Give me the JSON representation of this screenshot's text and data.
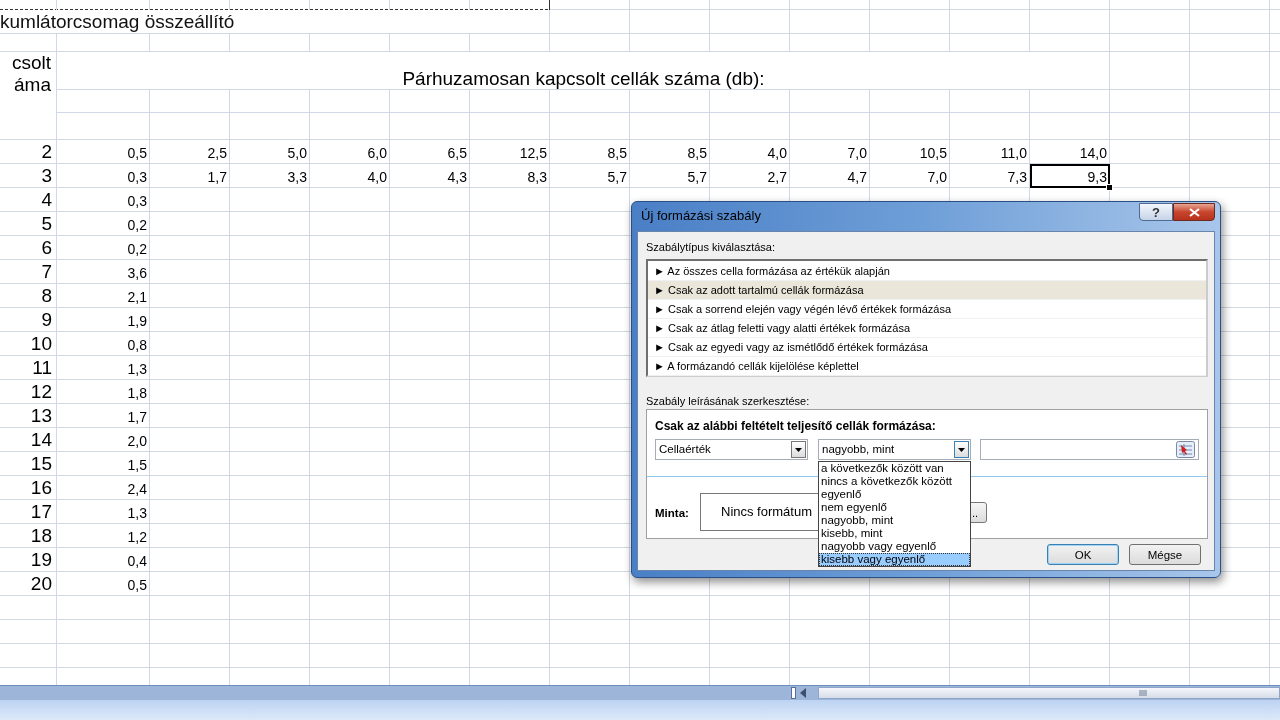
{
  "sheet": {
    "title": "kumlátorcsomag összeállító",
    "left_header": "csolt\náma",
    "header": "Párhuzamosan kapcsolt cellák száma (db):",
    "rows": [
      {
        "label": "2",
        "cells": [
          {
            "text": "0,5",
            "selected": false
          },
          {
            "text": "2,5",
            "selected": false
          },
          {
            "text": "5,0",
            "selected": false
          },
          {
            "text": "6,0",
            "selected": false
          },
          {
            "text": "6,5",
            "selected": false
          },
          {
            "text": "12,5",
            "selected": false
          },
          {
            "text": "8,5",
            "selected": false
          },
          {
            "text": "8,5",
            "selected": false
          },
          {
            "text": "4,0",
            "selected": false
          },
          {
            "text": "7,0",
            "selected": false
          },
          {
            "text": "10,5",
            "selected": false
          },
          {
            "text": "11,0",
            "selected": false
          },
          {
            "text": "14,0",
            "selected": false
          }
        ]
      },
      {
        "label": "3",
        "cells": [
          {
            "text": "0,3",
            "selected": false
          },
          {
            "text": "1,7",
            "selected": false
          },
          {
            "text": "3,3",
            "selected": false
          },
          {
            "text": "4,0",
            "selected": false
          },
          {
            "text": "4,3",
            "selected": false
          },
          {
            "text": "8,3",
            "selected": false
          },
          {
            "text": "5,7",
            "selected": false
          },
          {
            "text": "5,7",
            "selected": false
          },
          {
            "text": "2,7",
            "selected": false
          },
          {
            "text": "4,7",
            "selected": false
          },
          {
            "text": "7,0",
            "selected": false
          },
          {
            "text": "7,3",
            "selected": false
          },
          {
            "text": "9,3",
            "selected": true
          }
        ]
      },
      {
        "label": "4",
        "cells": [
          {
            "text": "0,3",
            "selected": false
          }
        ]
      },
      {
        "label": "5",
        "cells": [
          {
            "text": "0,2",
            "selected": false
          }
        ]
      },
      {
        "label": "6",
        "cells": [
          {
            "text": "0,2",
            "selected": false
          }
        ]
      },
      {
        "label": "7",
        "cells": [
          {
            "text": "3,6",
            "selected": false
          }
        ]
      },
      {
        "label": "8",
        "cells": [
          {
            "text": "2,1",
            "selected": false
          }
        ]
      },
      {
        "label": "9",
        "cells": [
          {
            "text": "1,9",
            "selected": false
          }
        ]
      },
      {
        "label": "10",
        "cells": [
          {
            "text": "0,8",
            "selected": false
          }
        ]
      },
      {
        "label": "11",
        "cells": [
          {
            "text": "1,3",
            "selected": false
          }
        ]
      },
      {
        "label": "12",
        "cells": [
          {
            "text": "1,8",
            "selected": false
          }
        ]
      },
      {
        "label": "13",
        "cells": [
          {
            "text": "1,7",
            "selected": false
          }
        ]
      },
      {
        "label": "14",
        "cells": [
          {
            "text": "2,0",
            "selected": false
          }
        ]
      },
      {
        "label": "15",
        "cells": [
          {
            "text": "1,5",
            "selected": false
          }
        ]
      },
      {
        "label": "16",
        "cells": [
          {
            "text": "2,4",
            "selected": false
          }
        ]
      },
      {
        "label": "17",
        "cells": [
          {
            "text": "1,3",
            "selected": false
          }
        ]
      },
      {
        "label": "18",
        "cells": [
          {
            "text": "1,2",
            "selected": false
          }
        ]
      },
      {
        "label": "19",
        "cells": [
          {
            "text": "0,4",
            "selected": false
          }
        ]
      },
      {
        "label": "20",
        "cells": [
          {
            "text": "0,5",
            "selected": false
          }
        ]
      }
    ]
  },
  "dialog": {
    "title": "Új formázási szabály",
    "help_button": "?",
    "rule_type_label": "Szabálytípus kiválasztása:",
    "rule_types": [
      {
        "text": "► Az összes cella formázása az értékük alapján",
        "selected": false
      },
      {
        "text": "► Csak az adott tartalmú cellák formázása",
        "selected": true
      },
      {
        "text": "► Csak a sorrend elején vagy végén lévő értékek formázása",
        "selected": false
      },
      {
        "text": "► Csak az átlag feletti vagy alatti értékek formázása",
        "selected": false
      },
      {
        "text": "► Csak az egyedi vagy az ismétlődő értékek formázása",
        "selected": false
      },
      {
        "text": "► A formázandó cellák kijelölése képlettel",
        "selected": false
      }
    ],
    "edit_label": "Szabály leírásának szerkesztése:",
    "condition_heading": "Csak az alábbi feltételt teljesítő cellák formázása:",
    "subject_combo": "Cellaérték",
    "operator_combo": "nagyobb, mint",
    "operator_options": [
      {
        "text": "a következők között van",
        "selected": false
      },
      {
        "text": "nincs a következők között",
        "selected": false
      },
      {
        "text": "egyenlő",
        "selected": false
      },
      {
        "text": "nem egyenlő",
        "selected": false
      },
      {
        "text": "nagyobb, mint",
        "selected": false
      },
      {
        "text": "kisebb, mint",
        "selected": false
      },
      {
        "text": "nagyobb vagy egyenlő",
        "selected": false
      },
      {
        "text": "kisebb vagy egyenlő",
        "selected": true
      }
    ],
    "preview_label": "Minta:",
    "preview_text": "Nincs formátum",
    "format_button": "..",
    "ok_button": "OK",
    "cancel_button": "Mégse"
  }
}
